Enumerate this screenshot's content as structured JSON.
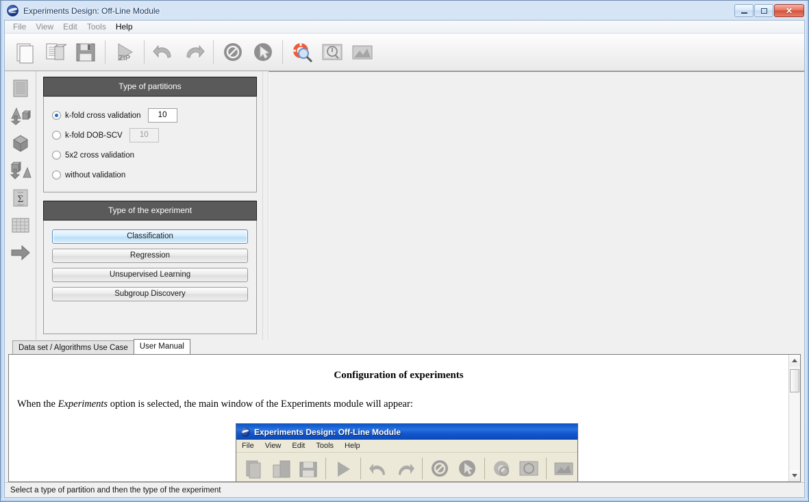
{
  "window": {
    "title": "Experiments Design: Off-Line Module",
    "icon": "globe-icon",
    "controls": {
      "minimize": "minimize-button",
      "maximize": "maximize-button",
      "close_label": "✕"
    }
  },
  "menubar": {
    "items": [
      {
        "label": "File",
        "enabled": false
      },
      {
        "label": "View",
        "enabled": false
      },
      {
        "label": "Edit",
        "enabled": false
      },
      {
        "label": "Tools",
        "enabled": false
      },
      {
        "label": "Help",
        "enabled": true
      }
    ]
  },
  "toolbar": {
    "buttons": [
      {
        "name": "new-document-icon"
      },
      {
        "name": "open-folder-icon"
      },
      {
        "name": "save-floppy-icon"
      },
      {
        "name": "run-zip-icon"
      },
      {
        "name": "undo-icon"
      },
      {
        "name": "redo-icon"
      },
      {
        "name": "cancel-icon"
      },
      {
        "name": "select-arrow-icon"
      },
      {
        "name": "help-lifesaver-icon"
      },
      {
        "name": "zoom-preview-icon"
      },
      {
        "name": "image-graph-icon"
      }
    ]
  },
  "left_rail": {
    "buttons": [
      {
        "name": "document-icon"
      },
      {
        "name": "shapes-split-icon"
      },
      {
        "name": "cube-icon"
      },
      {
        "name": "shapes-merge-icon"
      },
      {
        "name": "sigma-sum-icon"
      },
      {
        "name": "grid-table-icon"
      },
      {
        "name": "arrow-right-icon"
      }
    ]
  },
  "partitions": {
    "header": "Type of partitions",
    "options": [
      {
        "label": "k-fold cross validation",
        "selected": true,
        "value": "10",
        "value_enabled": true
      },
      {
        "label": "k-fold DOB-SCV",
        "selected": false,
        "value": "10",
        "value_enabled": false
      },
      {
        "label": "5x2 cross validation",
        "selected": false,
        "value": null,
        "value_enabled": false
      },
      {
        "label": "without validation",
        "selected": false,
        "value": null,
        "value_enabled": false
      }
    ]
  },
  "experiment": {
    "header": "Type of the experiment",
    "buttons": [
      {
        "label": "Classification",
        "selected": true
      },
      {
        "label": "Regression",
        "selected": false
      },
      {
        "label": "Unsupervised Learning",
        "selected": false
      },
      {
        "label": "Subgroup Discovery",
        "selected": false
      }
    ]
  },
  "tabs": [
    {
      "label": "Data set / Algorithms Use Case",
      "active": false
    },
    {
      "label": "User Manual",
      "active": true
    }
  ],
  "manual": {
    "title": "Configuration of experiments",
    "paragraph_before": "When the ",
    "paragraph_italic": "Experiments",
    "paragraph_after": " option is selected, the main window of the Experiments module will appear:",
    "embedded_screenshot": {
      "title": "Experiments Design: Off-Line Module",
      "menu": [
        "File",
        "View",
        "Edit",
        "Tools",
        "Help"
      ]
    }
  },
  "scrollbar": {
    "up_arrow": "scroll-up-arrow",
    "down_arrow": "scroll-down-arrow",
    "thumb": "scroll-thumb"
  },
  "statusbar": {
    "text": "Select a type of partition and then the type of the experiment"
  },
  "colors": {
    "group_header_bg": "#5a5a5a",
    "selected_button": "#b8e0f8",
    "accent_radio": "#1b6ec2",
    "title_bar": "#d6e5f5",
    "close_button": "#d4513a"
  }
}
